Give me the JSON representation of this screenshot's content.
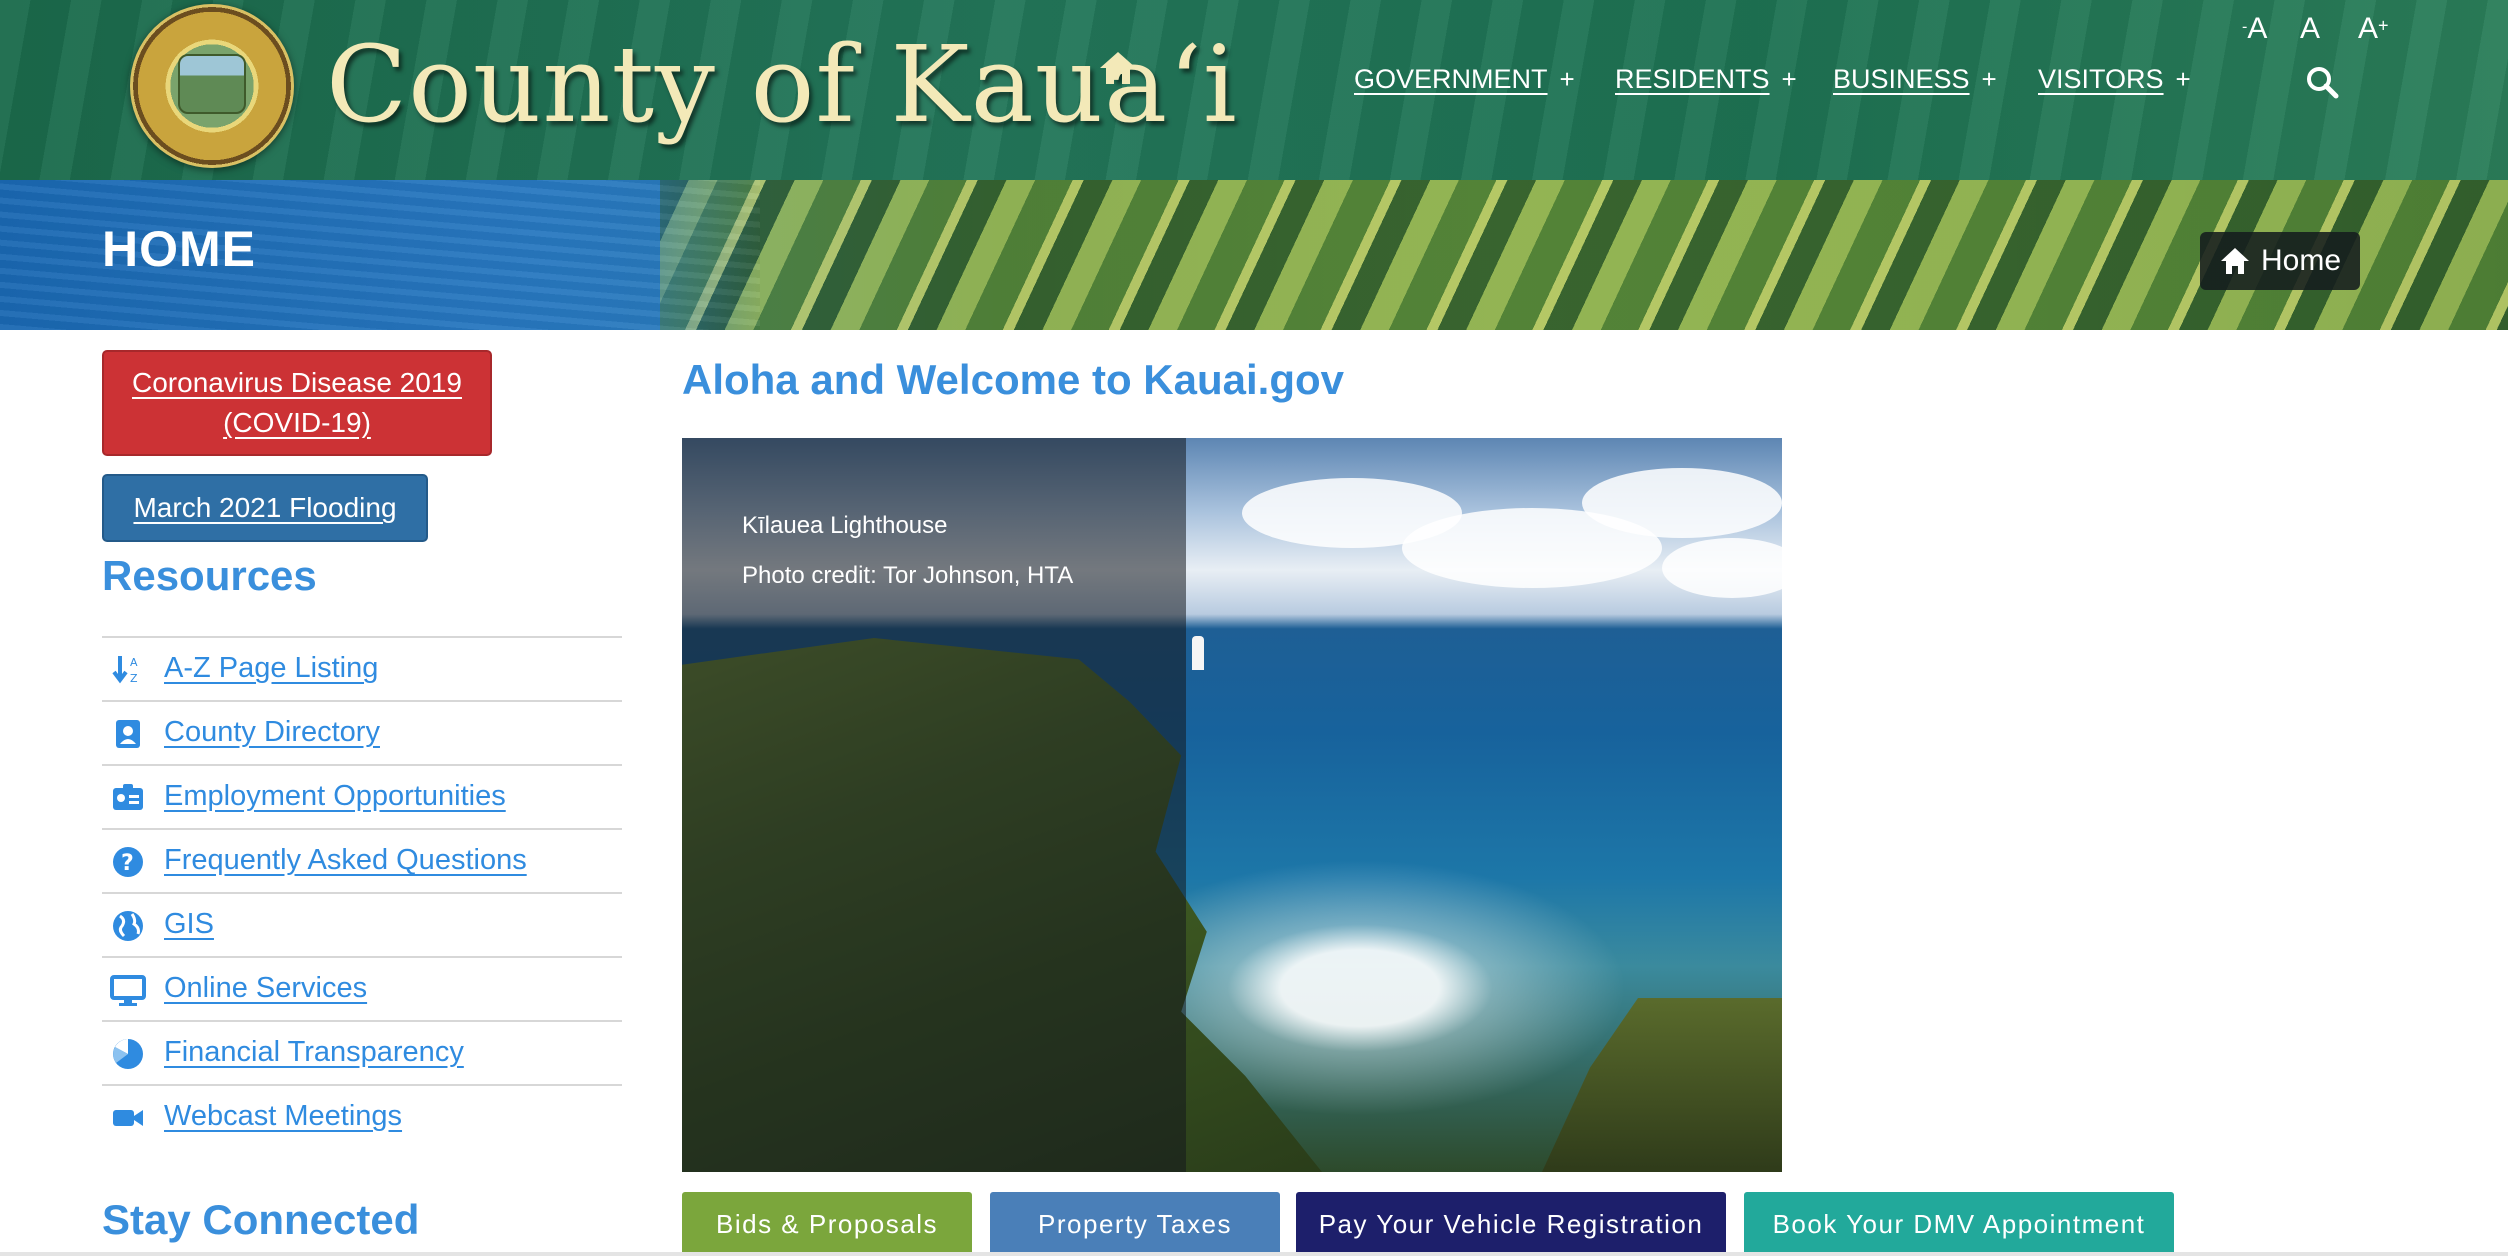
{
  "header": {
    "site_title": "County of Kaua‘i",
    "nav": [
      {
        "label": "GOVERNMENT",
        "plus": "+"
      },
      {
        "label": "RESIDENTS",
        "plus": "+"
      },
      {
        "label": "BUSINESS",
        "plus": "+"
      },
      {
        "label": "VISITORS",
        "plus": "+"
      }
    ],
    "font_sizes": [
      {
        "label": "A",
        "prefix": "-"
      },
      {
        "label": "A",
        "prefix": ""
      },
      {
        "label": "A",
        "prefix": "+"
      }
    ]
  },
  "banner": {
    "title": "HOME",
    "breadcrumb": "Home"
  },
  "sidebar": {
    "alerts": [
      {
        "label": "Coronavirus Disease 2019 (COVID-19)",
        "color": "#cc3235"
      },
      {
        "label": "March 2021 Flooding",
        "color": "#2f6fa5"
      }
    ],
    "resources_heading": "Resources",
    "resources": [
      {
        "label": "A-Z Page Listing",
        "icon": "sort-alpha-icon"
      },
      {
        "label": "County Directory",
        "icon": "contact-book-icon"
      },
      {
        "label": "Employment Opportunities",
        "icon": "id-badge-icon"
      },
      {
        "label": "Frequently Asked Questions",
        "icon": "question-circle-icon"
      },
      {
        "label": "GIS",
        "icon": "globe-icon"
      },
      {
        "label": "Online Services",
        "icon": "monitor-icon"
      },
      {
        "label": "Financial Transparency",
        "icon": "pie-chart-icon"
      },
      {
        "label": "Webcast Meetings",
        "icon": "video-camera-icon"
      }
    ],
    "stay_connected": "Stay Connected"
  },
  "main": {
    "welcome": "Aloha and Welcome to Kauai.gov",
    "hero": {
      "caption_title": "Kīlauea Lighthouse",
      "caption_credit": "Photo credit: Tor Johnson, HTA"
    },
    "quick_links": [
      {
        "label": "Bids & Proposals",
        "color": "#7ba63c"
      },
      {
        "label": "Property Taxes",
        "color": "#4a7fb8"
      },
      {
        "label": "Pay Your Vehicle Registration",
        "color": "#1d1f6b"
      },
      {
        "label": "Book Your DMV Appointment",
        "color": "#22a99b"
      }
    ]
  },
  "colors": {
    "link_blue": "#2f8be0",
    "heading_blue": "#3a8fdc",
    "header_green": "#1b6b4c"
  }
}
